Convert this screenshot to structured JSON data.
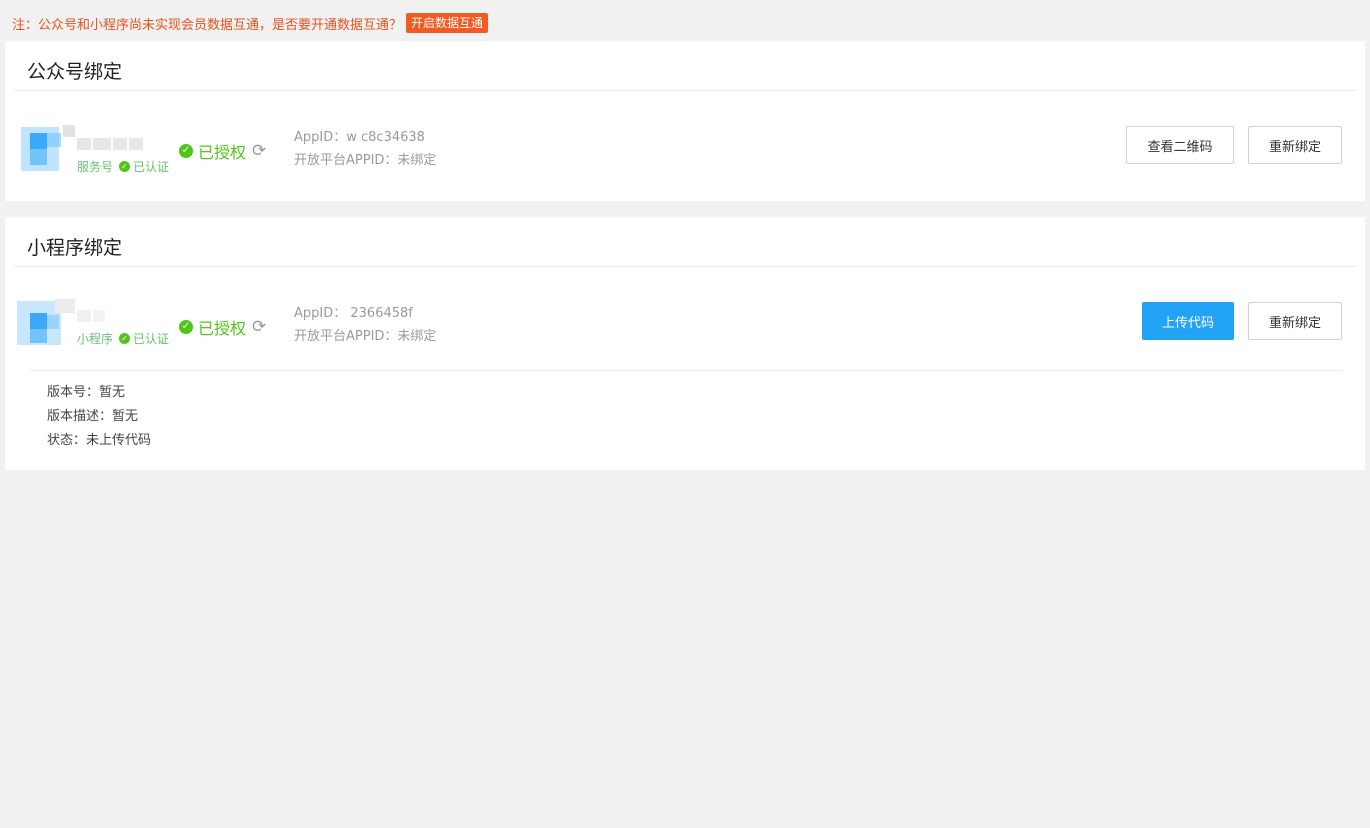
{
  "notice": {
    "text": "注：公众号和小程序尚未实现会员数据互通，是否要开通数据互通？",
    "button": "开启数据互通"
  },
  "official_account": {
    "title": "公众号绑定",
    "type_label": "服务号",
    "verified": "已认证",
    "auth_status": "已授权",
    "appid_label": "AppID：",
    "appid_value": "w         c8c34638",
    "open_platform_label": "开放平台APPID：",
    "open_platform_value": "未绑定",
    "btn_qrcode": "查看二维码",
    "btn_rebind": "重新绑定"
  },
  "mini_program": {
    "title": "小程序绑定",
    "type_label": "小程序",
    "verified": "已认证",
    "auth_status": "已授权",
    "appid_label": "AppID：",
    "appid_value": "         2366458f",
    "open_platform_label": "开放平台APPID：",
    "open_platform_value": "未绑定",
    "btn_upload": "上传代码",
    "btn_rebind": "重新绑定",
    "version_no": "版本号：暂无",
    "version_desc": "版本描述：暂无",
    "status": "状态：未上传代码"
  },
  "colors": {
    "accent": "#23a3f5",
    "notice": "#e6541f",
    "success": "#52c41a"
  },
  "icons": {
    "check": "check-circle-icon",
    "refresh": "refresh-icon"
  }
}
